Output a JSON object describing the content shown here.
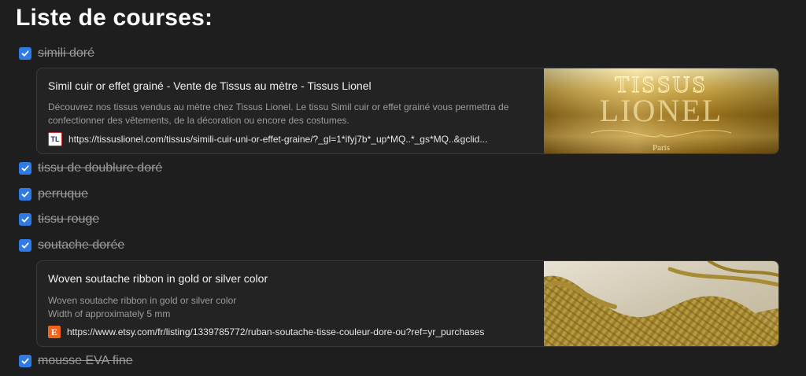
{
  "page": {
    "title": "Liste de courses:"
  },
  "items": [
    {
      "label": "simili doré",
      "checked": true
    },
    {
      "label": "tissu de doublure doré",
      "checked": true
    },
    {
      "label": "perruque",
      "checked": true
    },
    {
      "label": "tissu rouge",
      "checked": true
    },
    {
      "label": "soutache dorée",
      "checked": true
    },
    {
      "label": "mousse EVA fine",
      "checked": true
    }
  ],
  "bookmarks": [
    {
      "title": "Simil cuir or effet grainé - Vente de Tissus au mètre - Tissus Lionel",
      "description": "Découvrez nos tissus vendus au mètre chez Tissus Lionel. Le tissu Simil cuir or effet grainé vous permettra de confectionner des vêtements, de la décoration ou encore des costumes.",
      "url": "https://tissuslionel.com/tissus/simili-cuir-uni-or-effet-graine/?_gl=1*ifyj7b*_up*MQ..*_gs*MQ..&gclid...",
      "favicon_text": "TL",
      "image_text_1": "TISSUS",
      "image_text_2": "LIONEL",
      "image_text_3": "Paris"
    },
    {
      "title": "Woven soutache ribbon in gold or silver color",
      "description_line1": "Woven soutache ribbon in gold or silver color",
      "description_line2": "Width of approximately 5 mm",
      "url": "https://www.etsy.com/fr/listing/1339785772/ruban-soutache-tisse-couleur-dore-ou?ref=yr_purchases",
      "favicon_text": "E"
    }
  ],
  "colors": {
    "checkbox": "#2f7ae5",
    "background": "#1e1e1e",
    "gold": "#c9a53c"
  },
  "icons": {
    "checkbox": "checkmark-icon",
    "favicon_1": "tissus-lionel-favicon-icon",
    "favicon_2": "etsy-favicon-icon"
  }
}
